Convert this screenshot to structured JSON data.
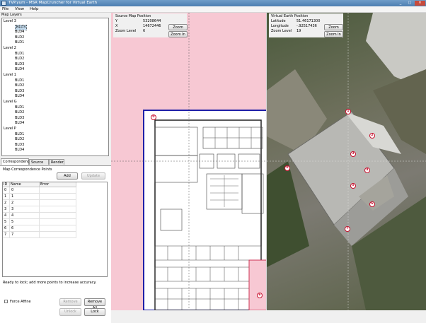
{
  "window": {
    "title": "TVP.yum - MSR MapCruncher for Virtual Earth",
    "buttons": [
      "_",
      "□",
      "✕"
    ]
  },
  "menu": [
    "File",
    "View",
    "Help"
  ],
  "map_layers": {
    "label": "Map Layers",
    "tree": [
      {
        "label": "Level 3",
        "children": [
          "BLD3",
          "BLD4",
          "BLD2",
          "BLD1"
        ],
        "selected": "BLD3"
      },
      {
        "label": "Level 2",
        "children": [
          "BLD1",
          "BLD2",
          "BLD3",
          "BLD4"
        ]
      },
      {
        "label": "Level 1",
        "children": [
          "BLD1",
          "BLD2",
          "BLD3",
          "BLD4"
        ]
      },
      {
        "label": "Level G",
        "children": [
          "BLD1",
          "BLD2",
          "BLD3",
          "BLD4"
        ]
      },
      {
        "label": "Level P",
        "children": [
          "BLD1",
          "BLD2",
          "BLD3",
          "BLD4"
        ]
      }
    ]
  },
  "tabs": [
    "Correspondences",
    "Source Info",
    "Render"
  ],
  "correspondences": {
    "group_label": "Map Correspondence Points",
    "add_label": "Add",
    "update_label": "Update",
    "columns": [
      "ID",
      "Name",
      "Error"
    ],
    "rows": [
      [
        "0",
        "0",
        ""
      ],
      [
        "1",
        "1",
        ""
      ],
      [
        "2",
        "2",
        ""
      ],
      [
        "3",
        "3",
        ""
      ],
      [
        "4",
        "4",
        ""
      ],
      [
        "5",
        "5",
        ""
      ],
      [
        "6",
        "6",
        ""
      ],
      [
        "7",
        "7",
        ""
      ]
    ],
    "status": "Ready to lock; add more points to increase accuracy.",
    "force_affine_label": "Force Affine",
    "remove_label": "Remove",
    "remove_all_label": "Remove All",
    "unlock_label": "Unlock",
    "lock_label": "Lock"
  },
  "source_position": {
    "title": "Source Map Position",
    "y_label": "Y",
    "y_value": "53208644",
    "x_label": "X",
    "x_value": "14672446",
    "zoom_label": "Zoom Level",
    "zoom_value": "6",
    "zoom_out": "Zoom Out",
    "zoom_in": "Zoom In"
  },
  "ve_position": {
    "title": "Virtual Earth Position",
    "lat_label": "Latitude",
    "lat_value": "51.46171300",
    "lon_label": "Longitude",
    "lon_value": "-.92517436",
    "zoom_label": "Zoom Level",
    "zoom_value": "19",
    "zoom_out": "Zoom Out",
    "zoom_in": "Zoom In"
  },
  "pins": [
    "1",
    "2",
    "3",
    "4",
    "5",
    "6",
    "7",
    "0"
  ],
  "colors": {
    "source_bg": "#f7c8d3",
    "pin": "#c8102e",
    "title_bar": "#4d7eb1"
  }
}
